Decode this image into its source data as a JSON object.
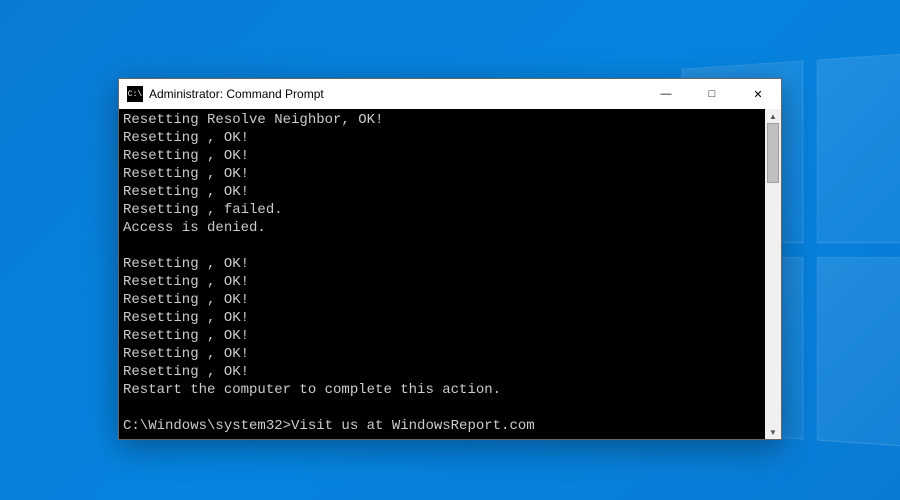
{
  "titlebar": {
    "icon_text": "C:\\",
    "title": "Administrator: Command Prompt",
    "minimize": "—",
    "maximize": "□",
    "close": "✕"
  },
  "terminal": {
    "lines": [
      "Resetting Resolve Neighbor, OK!",
      "Resetting , OK!",
      "Resetting , OK!",
      "Resetting , OK!",
      "Resetting , OK!",
      "Resetting , failed.",
      "Access is denied.",
      "",
      "Resetting , OK!",
      "Resetting , OK!",
      "Resetting , OK!",
      "Resetting , OK!",
      "Resetting , OK!",
      "Resetting , OK!",
      "Resetting , OK!",
      "Restart the computer to complete this action.",
      ""
    ],
    "prompt_prefix": "C:\\Windows\\system32>",
    "prompt_command": "Visit us at WindowsReport.com"
  },
  "scrollbar": {
    "arrow_up": "▲",
    "arrow_down": "▼"
  }
}
